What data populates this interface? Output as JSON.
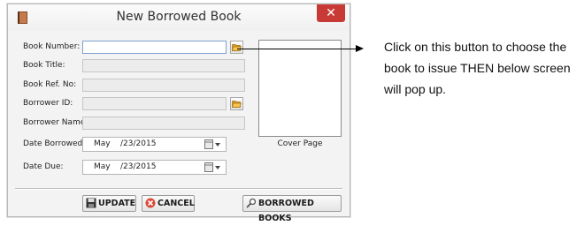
{
  "window": {
    "title": "New Borrowed Book",
    "close_glyph": "✕",
    "app_icon": "book-icon"
  },
  "form": {
    "book_number_label": "Book Number:",
    "book_title_label": "Book Title:",
    "book_ref_label": "Book Ref. No:",
    "borrower_id_label": "Borrower ID:",
    "borrower_name_label": "Borrower Name:",
    "date_borrowed_label": "Date Borrowed:",
    "date_due_label": "Date Due:",
    "date_borrowed": {
      "month": "May",
      "rest": "/23/2015"
    },
    "date_due": {
      "month": "May",
      "rest": "/23/2015"
    },
    "cover_label": "Cover Page"
  },
  "buttons": {
    "update": "UPDATE",
    "cancel": "CANCEL",
    "borrowed_books": "BORROWED BOOKS"
  },
  "annotation": {
    "text": "Click on this button  to choose the book  to issue THEN below screen will pop up."
  },
  "colors": {
    "close": "#c83a36",
    "focus_border": "#7da2ce",
    "folder": "#f2b636"
  }
}
